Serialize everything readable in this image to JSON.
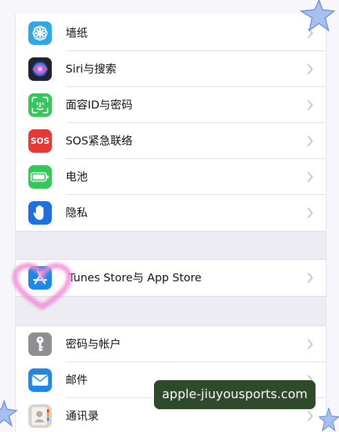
{
  "settings": {
    "rows": [
      {
        "id": "wallpaper",
        "label": "墙纸",
        "icon": "flower-icon",
        "icon_bg": "#2fa8e8"
      },
      {
        "id": "siri",
        "label": "Siri与搜索",
        "icon": "siri-icon",
        "icon_bg": "#222233"
      },
      {
        "id": "faceid",
        "label": "面容ID与密码",
        "icon": "face-id-icon",
        "icon_bg": "#34c759"
      },
      {
        "id": "sos",
        "label": "SOS紧急联络",
        "icon": "sos-icon",
        "icon_bg": "#e53935",
        "icon_text": "SOS"
      },
      {
        "id": "battery",
        "label": "电池",
        "icon": "battery-icon",
        "icon_bg": "#34c759"
      },
      {
        "id": "privacy",
        "label": "隐私",
        "icon": "hand-icon",
        "icon_bg": "#1e6fe0"
      },
      {
        "id": "appstore",
        "label": "Tunes Store与 App Store",
        "icon": "app-store-icon",
        "icon_bg": "#1e88e5"
      },
      {
        "id": "passwords",
        "label": "密码与帐户",
        "icon": "key-icon",
        "icon_bg": "#8e8e93"
      },
      {
        "id": "mail",
        "label": "邮件",
        "icon": "mail-icon",
        "icon_bg": "#1e88e5"
      },
      {
        "id": "contacts",
        "label": "通讯录",
        "icon": "contacts-icon",
        "icon_bg": "#d8d4cc"
      }
    ]
  },
  "watermark": {
    "text": "apple-jiuyousports.com"
  },
  "colors": {
    "accent": "#1e88e5",
    "chevron": "#c4c4c9",
    "group_gap": "#ececf2"
  }
}
